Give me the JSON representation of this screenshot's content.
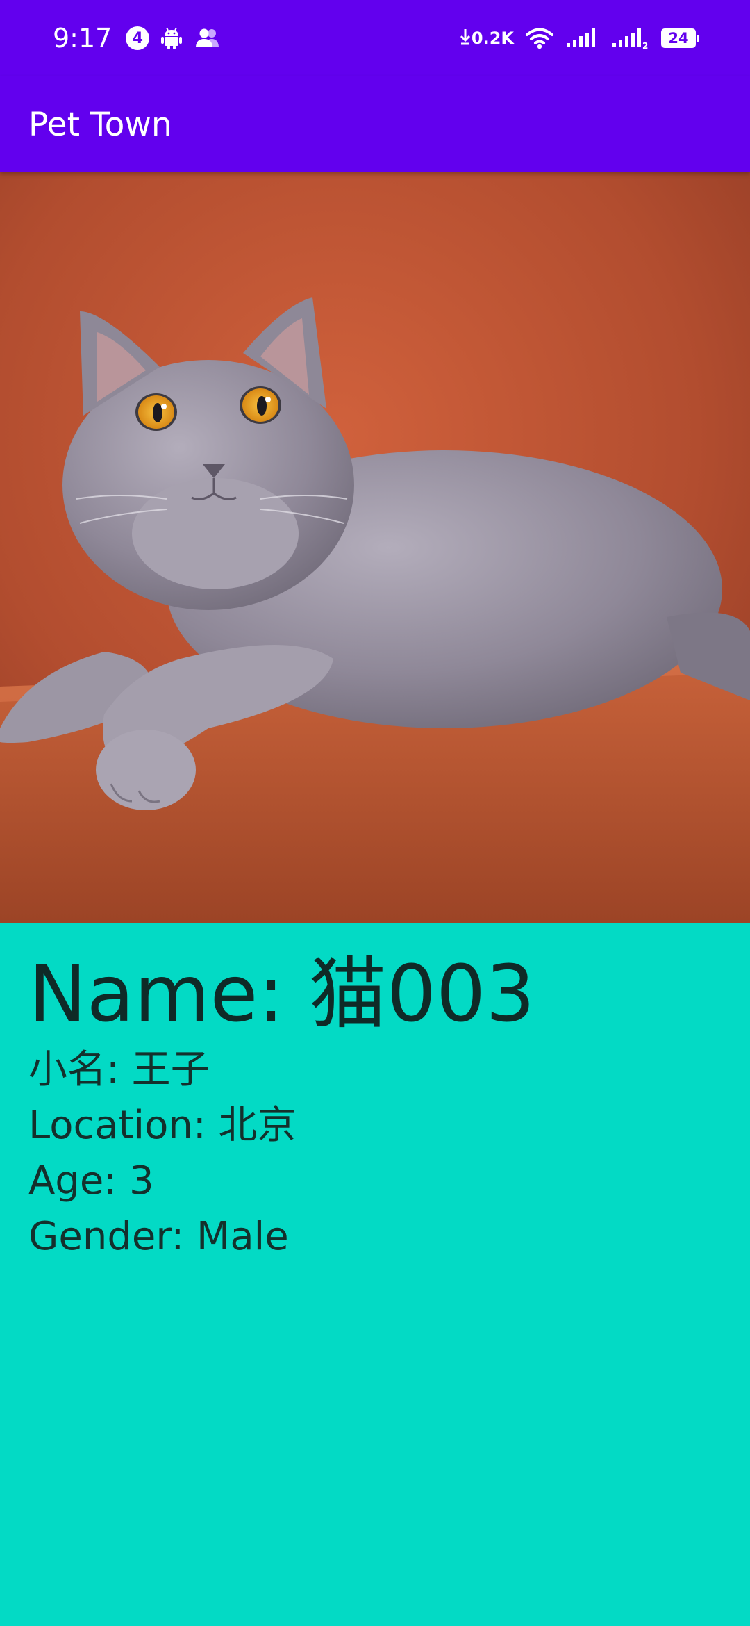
{
  "status_bar": {
    "time": "9:17",
    "notification_count": "4",
    "net_speed": "0.2K",
    "sim2_label": "2",
    "battery_level": "24"
  },
  "app_bar": {
    "title": "Pet Town"
  },
  "pet": {
    "photo_icon": "cat-photo",
    "name_label": "Name: ",
    "name_value": "猫003",
    "nickname_label": "小名: ",
    "nickname_value": "王子",
    "location_label": "Location: ",
    "location_value": "北京",
    "age_label": "Age: ",
    "age_value": "3",
    "gender_label": "Gender: ",
    "gender_value": "Male"
  },
  "colors": {
    "primary": "#6200EE",
    "background": "#03DAC5",
    "text": "#14302C",
    "photo_backdrop": "#A8432A"
  }
}
